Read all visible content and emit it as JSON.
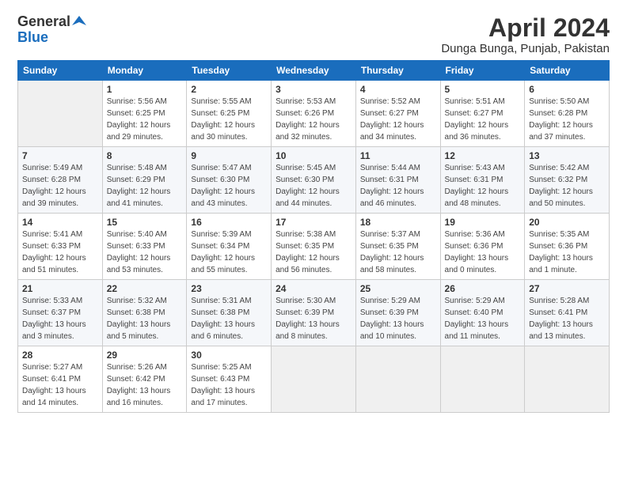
{
  "logo": {
    "general": "General",
    "blue": "Blue"
  },
  "header": {
    "title": "April 2024",
    "location": "Dunga Bunga, Punjab, Pakistan"
  },
  "weekdays": [
    "Sunday",
    "Monday",
    "Tuesday",
    "Wednesday",
    "Thursday",
    "Friday",
    "Saturday"
  ],
  "weeks": [
    [
      {
        "num": "",
        "empty": true
      },
      {
        "num": "1",
        "sunrise": "5:56 AM",
        "sunset": "6:25 PM",
        "daylight": "12 hours and 29 minutes."
      },
      {
        "num": "2",
        "sunrise": "5:55 AM",
        "sunset": "6:25 PM",
        "daylight": "12 hours and 30 minutes."
      },
      {
        "num": "3",
        "sunrise": "5:53 AM",
        "sunset": "6:26 PM",
        "daylight": "12 hours and 32 minutes."
      },
      {
        "num": "4",
        "sunrise": "5:52 AM",
        "sunset": "6:27 PM",
        "daylight": "12 hours and 34 minutes."
      },
      {
        "num": "5",
        "sunrise": "5:51 AM",
        "sunset": "6:27 PM",
        "daylight": "12 hours and 36 minutes."
      },
      {
        "num": "6",
        "sunrise": "5:50 AM",
        "sunset": "6:28 PM",
        "daylight": "12 hours and 37 minutes."
      }
    ],
    [
      {
        "num": "7",
        "sunrise": "5:49 AM",
        "sunset": "6:28 PM",
        "daylight": "12 hours and 39 minutes."
      },
      {
        "num": "8",
        "sunrise": "5:48 AM",
        "sunset": "6:29 PM",
        "daylight": "12 hours and 41 minutes."
      },
      {
        "num": "9",
        "sunrise": "5:47 AM",
        "sunset": "6:30 PM",
        "daylight": "12 hours and 43 minutes."
      },
      {
        "num": "10",
        "sunrise": "5:45 AM",
        "sunset": "6:30 PM",
        "daylight": "12 hours and 44 minutes."
      },
      {
        "num": "11",
        "sunrise": "5:44 AM",
        "sunset": "6:31 PM",
        "daylight": "12 hours and 46 minutes."
      },
      {
        "num": "12",
        "sunrise": "5:43 AM",
        "sunset": "6:31 PM",
        "daylight": "12 hours and 48 minutes."
      },
      {
        "num": "13",
        "sunrise": "5:42 AM",
        "sunset": "6:32 PM",
        "daylight": "12 hours and 50 minutes."
      }
    ],
    [
      {
        "num": "14",
        "sunrise": "5:41 AM",
        "sunset": "6:33 PM",
        "daylight": "12 hours and 51 minutes."
      },
      {
        "num": "15",
        "sunrise": "5:40 AM",
        "sunset": "6:33 PM",
        "daylight": "12 hours and 53 minutes."
      },
      {
        "num": "16",
        "sunrise": "5:39 AM",
        "sunset": "6:34 PM",
        "daylight": "12 hours and 55 minutes."
      },
      {
        "num": "17",
        "sunrise": "5:38 AM",
        "sunset": "6:35 PM",
        "daylight": "12 hours and 56 minutes."
      },
      {
        "num": "18",
        "sunrise": "5:37 AM",
        "sunset": "6:35 PM",
        "daylight": "12 hours and 58 minutes."
      },
      {
        "num": "19",
        "sunrise": "5:36 AM",
        "sunset": "6:36 PM",
        "daylight": "13 hours and 0 minutes."
      },
      {
        "num": "20",
        "sunrise": "5:35 AM",
        "sunset": "6:36 PM",
        "daylight": "13 hours and 1 minute."
      }
    ],
    [
      {
        "num": "21",
        "sunrise": "5:33 AM",
        "sunset": "6:37 PM",
        "daylight": "13 hours and 3 minutes."
      },
      {
        "num": "22",
        "sunrise": "5:32 AM",
        "sunset": "6:38 PM",
        "daylight": "13 hours and 5 minutes."
      },
      {
        "num": "23",
        "sunrise": "5:31 AM",
        "sunset": "6:38 PM",
        "daylight": "13 hours and 6 minutes."
      },
      {
        "num": "24",
        "sunrise": "5:30 AM",
        "sunset": "6:39 PM",
        "daylight": "13 hours and 8 minutes."
      },
      {
        "num": "25",
        "sunrise": "5:29 AM",
        "sunset": "6:39 PM",
        "daylight": "13 hours and 10 minutes."
      },
      {
        "num": "26",
        "sunrise": "5:29 AM",
        "sunset": "6:40 PM",
        "daylight": "13 hours and 11 minutes."
      },
      {
        "num": "27",
        "sunrise": "5:28 AM",
        "sunset": "6:41 PM",
        "daylight": "13 hours and 13 minutes."
      }
    ],
    [
      {
        "num": "28",
        "sunrise": "5:27 AM",
        "sunset": "6:41 PM",
        "daylight": "13 hours and 14 minutes."
      },
      {
        "num": "29",
        "sunrise": "5:26 AM",
        "sunset": "6:42 PM",
        "daylight": "13 hours and 16 minutes."
      },
      {
        "num": "30",
        "sunrise": "5:25 AM",
        "sunset": "6:43 PM",
        "daylight": "13 hours and 17 minutes."
      },
      {
        "num": "",
        "empty": true
      },
      {
        "num": "",
        "empty": true
      },
      {
        "num": "",
        "empty": true
      },
      {
        "num": "",
        "empty": true
      }
    ]
  ],
  "labels": {
    "sunrise": "Sunrise:",
    "sunset": "Sunset:",
    "daylight": "Daylight:"
  }
}
